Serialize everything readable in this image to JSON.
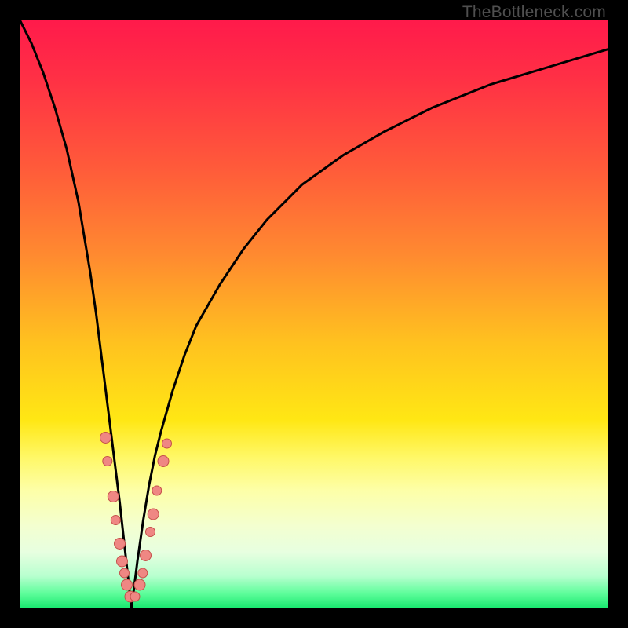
{
  "watermark": "TheBottleneck.com",
  "colors": {
    "frame": "#000000",
    "curve": "#000000",
    "marker_fill": "#ef8783",
    "marker_stroke": "#c5504a",
    "gradient_stops": [
      {
        "offset": 0.0,
        "color": "#ff1a4b"
      },
      {
        "offset": 0.1,
        "color": "#ff3045"
      },
      {
        "offset": 0.25,
        "color": "#ff5a3a"
      },
      {
        "offset": 0.4,
        "color": "#ff8a30"
      },
      {
        "offset": 0.55,
        "color": "#ffc21f"
      },
      {
        "offset": 0.68,
        "color": "#ffe714"
      },
      {
        "offset": 0.745,
        "color": "#fff869"
      },
      {
        "offset": 0.8,
        "color": "#fdffa8"
      },
      {
        "offset": 0.86,
        "color": "#f3ffd0"
      },
      {
        "offset": 0.905,
        "color": "#e7ffe0"
      },
      {
        "offset": 0.945,
        "color": "#b8ffcf"
      },
      {
        "offset": 0.975,
        "color": "#5dfd9a"
      },
      {
        "offset": 1.0,
        "color": "#17e86e"
      }
    ]
  },
  "chart_data": {
    "type": "line",
    "title": "",
    "xlabel": "",
    "ylabel": "",
    "xlim": [
      0,
      100
    ],
    "ylim": [
      0,
      100
    ],
    "note": "V-shaped bottleneck curve; y ≈ 100·|x − 19|/(x<19 ? 19 : 81)^p, visually steep left branch and shallow right branch. Markers cluster near the valley bottom.",
    "series": [
      {
        "name": "bottleneck-curve",
        "x": [
          0,
          2,
          4,
          6,
          8,
          10,
          12,
          13,
          14,
          15,
          16,
          17,
          18,
          19,
          20,
          21,
          22,
          23,
          24,
          26,
          28,
          30,
          34,
          38,
          42,
          48,
          55,
          62,
          70,
          80,
          90,
          100
        ],
        "y": [
          100,
          96,
          91,
          85,
          78,
          69,
          57,
          50,
          42,
          34,
          26,
          18,
          9,
          0,
          8,
          15,
          21,
          26,
          30,
          37,
          43,
          48,
          55,
          61,
          66,
          72,
          77,
          81,
          85,
          89,
          92,
          95
        ]
      }
    ],
    "markers": [
      {
        "x": 14.6,
        "y": 29,
        "r": 7
      },
      {
        "x": 14.9,
        "y": 25,
        "r": 6
      },
      {
        "x": 15.9,
        "y": 19,
        "r": 7
      },
      {
        "x": 16.3,
        "y": 15,
        "r": 6
      },
      {
        "x": 17.0,
        "y": 11,
        "r": 7
      },
      {
        "x": 17.4,
        "y": 8,
        "r": 7
      },
      {
        "x": 17.8,
        "y": 6,
        "r": 6
      },
      {
        "x": 18.2,
        "y": 4,
        "r": 7
      },
      {
        "x": 18.8,
        "y": 2,
        "r": 7
      },
      {
        "x": 19.6,
        "y": 2,
        "r": 6
      },
      {
        "x": 20.4,
        "y": 4,
        "r": 7
      },
      {
        "x": 20.9,
        "y": 6,
        "r": 6
      },
      {
        "x": 21.4,
        "y": 9,
        "r": 7
      },
      {
        "x": 22.2,
        "y": 13,
        "r": 6
      },
      {
        "x": 22.7,
        "y": 16,
        "r": 7
      },
      {
        "x": 23.3,
        "y": 20,
        "r": 6
      },
      {
        "x": 24.4,
        "y": 25,
        "r": 7
      },
      {
        "x": 25.0,
        "y": 28,
        "r": 6
      }
    ]
  }
}
